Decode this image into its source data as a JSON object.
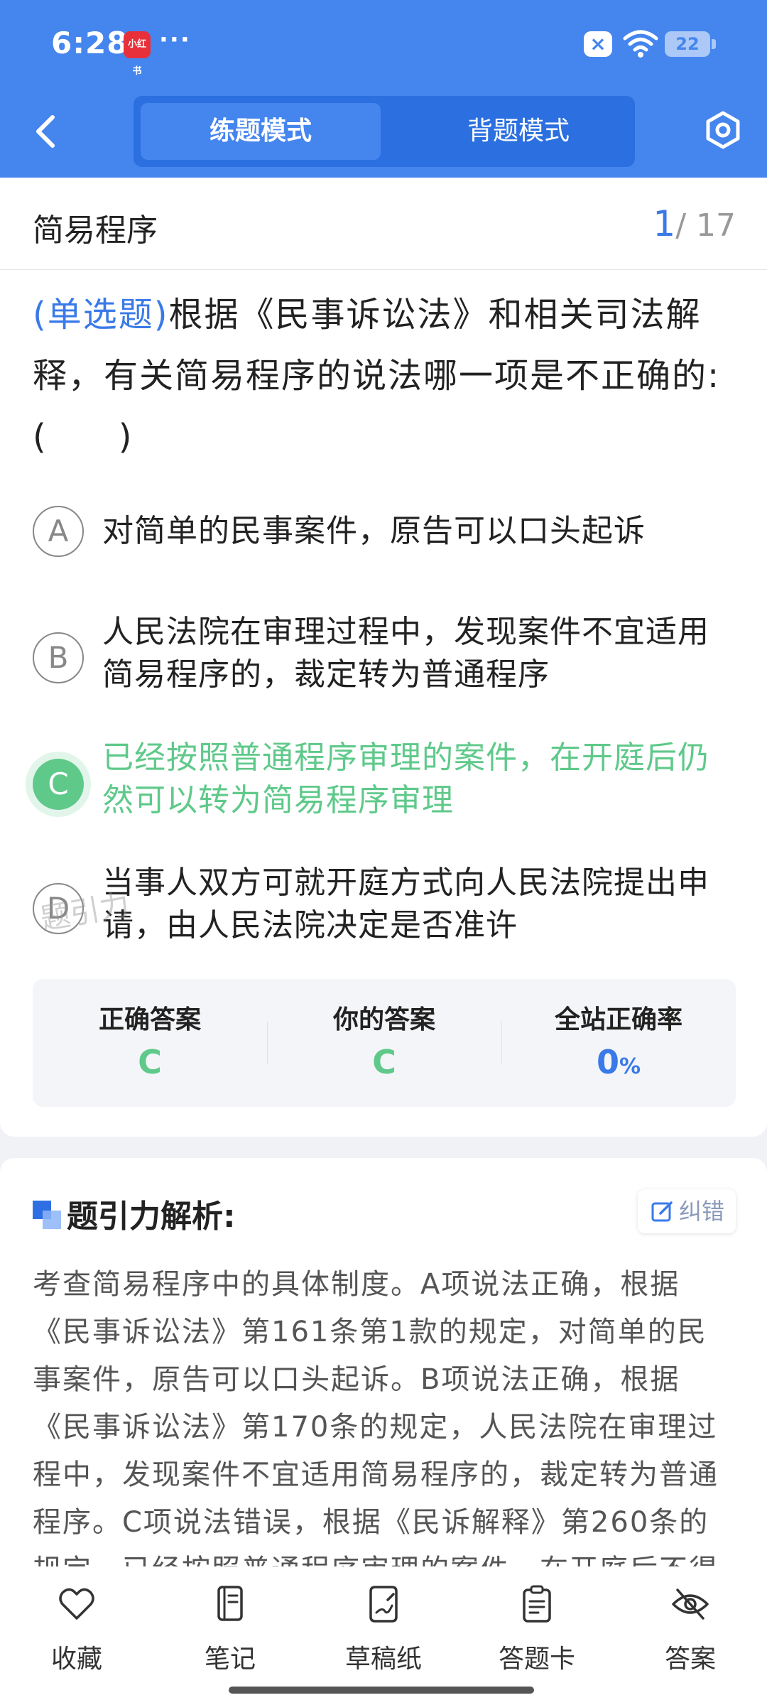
{
  "status_bar": {
    "time": "6:28",
    "app_badge": "小红书",
    "more": "···",
    "battery": "22"
  },
  "header": {
    "tabs": [
      {
        "label": "练题模式",
        "active": true
      },
      {
        "label": "背题模式",
        "active": false
      }
    ]
  },
  "section": {
    "title": "简易程序",
    "current": "1",
    "total": "/ 17"
  },
  "question": {
    "type": "(单选题)",
    "text": "根据《民事诉讼法》和相关司法解释，有关简易程序的说法哪一项是不正确的:(　　)"
  },
  "options": [
    {
      "letter": "A",
      "text": "对简单的民事案件，原告可以口头起诉",
      "state": "normal"
    },
    {
      "letter": "B",
      "text": "人民法院在审理过程中，发现案件不宜适用简易程序的，裁定转为普通程序",
      "state": "normal"
    },
    {
      "letter": "C",
      "text": "已经按照普通程序审理的案件，在开庭后仍然可以转为简易程序审理",
      "state": "correct"
    },
    {
      "letter": "D",
      "text": "当事人双方可就开庭方式向人民法院提出申请，由人民法院决定是否准许",
      "state": "normal"
    }
  ],
  "watermark": "题引力",
  "answer_panel": {
    "correct_label": "正确答案",
    "correct_value": "C",
    "yours_label": "你的答案",
    "yours_value": "C",
    "rate_label": "全站正确率",
    "rate_value": "0",
    "rate_unit": "%"
  },
  "analysis": {
    "title": "题引力解析:",
    "report_label": "纠错",
    "text": "考查简易程序中的具体制度。A项说法正确，根据《民事诉讼法》第161条第1款的规定，对简单的民事案件，原告可以口头起诉。B项说法正确，根据《民事诉讼法》第170条的规定，人民法院在审理过程中，发现案件不宜适用简易程序的，裁定转为普通程序。C项说法错误，根据《民诉解释》第260条的规定，已经按照普通程序审理的案件，在开庭后不得转为简易"
  },
  "bottom_nav": [
    {
      "label": "收藏",
      "icon": "heart-icon"
    },
    {
      "label": "笔记",
      "icon": "notebook-icon"
    },
    {
      "label": "草稿纸",
      "icon": "draft-icon"
    },
    {
      "label": "答题卡",
      "icon": "answer-card-icon"
    },
    {
      "label": "答案",
      "icon": "eye-off-icon"
    }
  ],
  "colors": {
    "brand_blue": "#4585ee",
    "correct_green": "#5fc98a",
    "accent_blue": "#3a7ae8"
  }
}
